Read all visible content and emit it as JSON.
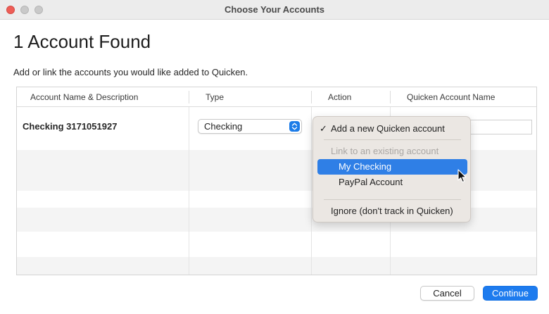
{
  "window": {
    "title": "Choose Your Accounts"
  },
  "page": {
    "heading": "1 Account Found",
    "subtext": "Add or link the accounts you would like added to Quicken."
  },
  "table": {
    "columns": [
      "Account Name & Description",
      "Type",
      "Action",
      "Quicken Account Name"
    ],
    "rows": [
      {
        "account_name": "Checking 3171051927",
        "type": "Checking"
      }
    ]
  },
  "action_menu": {
    "items": [
      {
        "label": "Add a new Quicken account",
        "checked": true,
        "state": "normal"
      },
      {
        "label": "Link to an existing account",
        "state": "disabled"
      },
      {
        "label": "My Checking",
        "state": "selected"
      },
      {
        "label": "PayPal Account",
        "state": "normal"
      },
      {
        "label": "Ignore (don't track in Quicken)",
        "state": "normal"
      }
    ],
    "check_glyph": "✓"
  },
  "buttons": {
    "cancel": "Cancel",
    "continue": "Continue"
  },
  "colors": {
    "accent": "#1d7bee",
    "menu_highlight": "#2f7fe6",
    "close_button": "#ee5d56"
  },
  "icons": {
    "stepper": "up-down-chevron-icon",
    "cursor": "mouse-pointer-icon"
  }
}
